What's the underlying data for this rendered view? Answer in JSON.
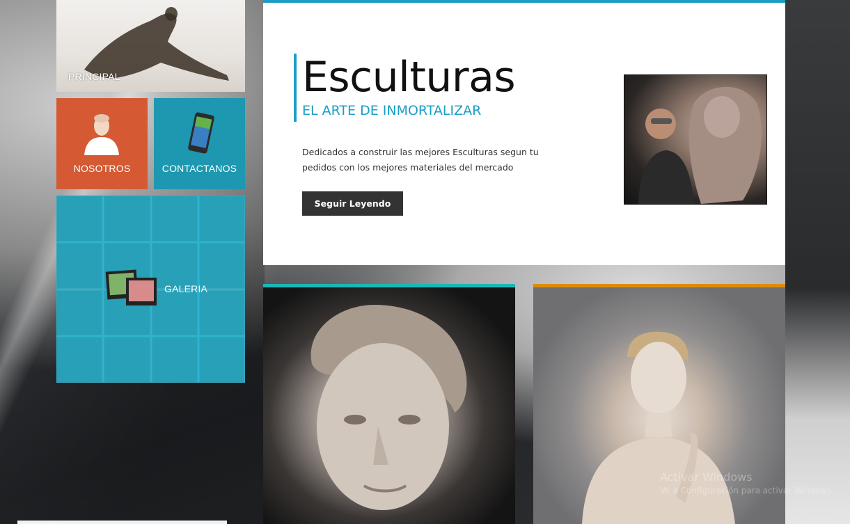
{
  "tiles": {
    "principal": {
      "label": "PRINCIPAL"
    },
    "nosotros": {
      "label": "NOSOTROS"
    },
    "contactanos": {
      "label": "CONTACTANOS"
    },
    "galeria": {
      "label": "GALERIA"
    }
  },
  "hero": {
    "title": "Esculturas",
    "subtitle": "EL ARTE DE INMORTALIZAR",
    "description": "Dedicados a construir las mejores Esculturas segun tu pedidos con los mejores materiales del mercado",
    "button_label": "Seguir Leyendo"
  },
  "watermark": {
    "title": "Activar Windows",
    "subtitle": "Ve a Configuración para activar Windows."
  },
  "colors": {
    "accent_blue": "#1b9ec4",
    "tile_orange": "#d55a33",
    "tile_teal": "#1d98b0",
    "tile_cyan": "#2fb3cd",
    "card_left_border": "#19b8b6",
    "card_right_border": "#de8c08"
  }
}
